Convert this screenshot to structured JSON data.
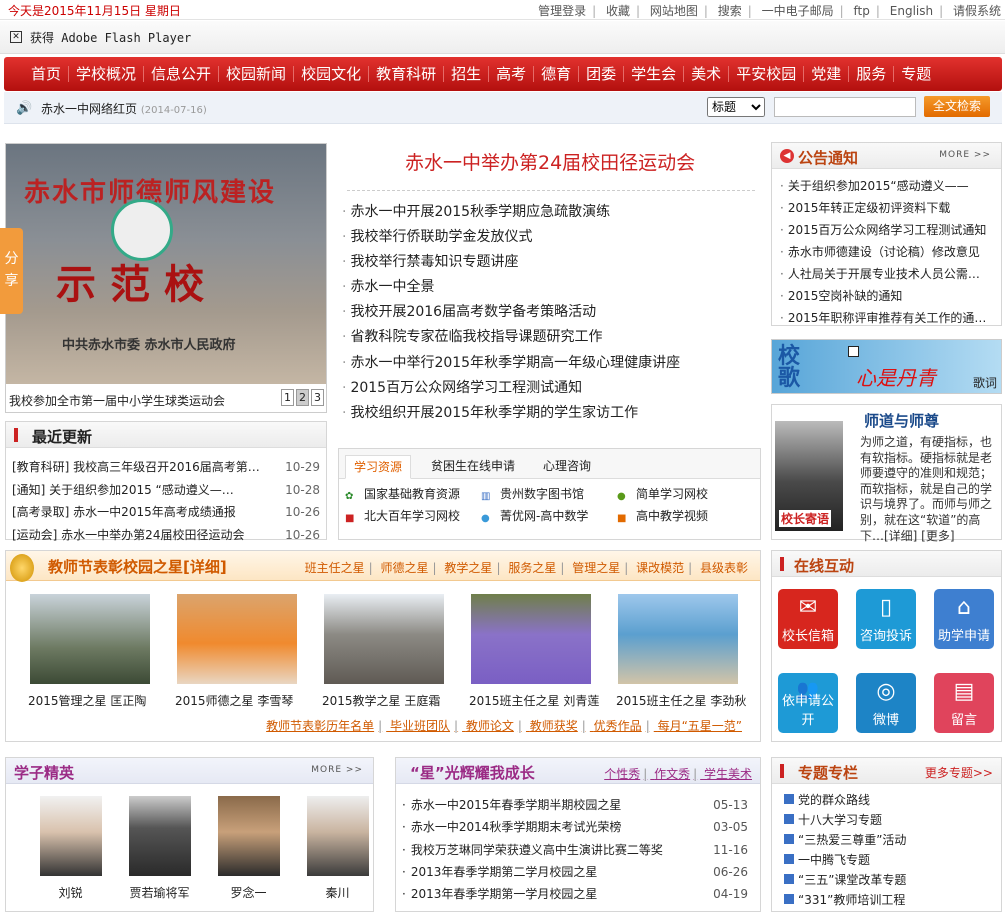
{
  "topbar": {
    "date": "今天是2015年11月15日  星期日",
    "links": [
      "管理登录",
      "收藏",
      "网站地图",
      "搜索",
      "一中电子邮局",
      "ftp",
      "English",
      "请假系统"
    ]
  },
  "flash": {
    "text": "获得 Adobe Flash Player"
  },
  "nav": [
    "首页",
    "学校概况",
    "信息公开",
    "校园新闻",
    "校园文化",
    "教育科研",
    "招生",
    "高考",
    "德育",
    "团委",
    "学生会",
    "美术",
    "平安校园",
    "党建",
    "服务",
    "专题"
  ],
  "ticker": {
    "title": "赤水一中网络红页",
    "date": "(2014-07-16)"
  },
  "search": {
    "select_value": "标题",
    "button": "全文检索"
  },
  "slideshow": {
    "caption": "我校参加全市第一届中小学生球类运动会",
    "pages": [
      "1",
      "2",
      "3"
    ],
    "share": "分享",
    "banner_top": "赤水市师德师风建设",
    "banner_mid": "示范校",
    "banner_bottom": "中共赤水市委   赤水市人民政府"
  },
  "headline": "赤水一中举办第24届校田径运动会",
  "headlines": [
    "赤水一中开展2015秋季学期应急疏散演练",
    "我校举行侨联助学金发放仪式",
    "我校举行禁毒知识专题讲座",
    "赤水一中全景",
    "我校开展2016届高考数学备考策略活动",
    "省教科院专家莅临我校指导课题研究工作",
    "赤水一中举行2015年秋季学期高一年级心理健康讲座",
    "2015百万公众网络学习工程测试通知",
    "我校组织开展2015年秋季学期的学生家访工作"
  ],
  "notice": {
    "title": "公告通知",
    "more": "MORE >>",
    "items": [
      "关于组织参加2015“感动遵义——",
      "2015年转正定级初评资料下载",
      "2015百万公众网络学习工程测试通知",
      "赤水市师德建设（讨论稿）修改意见",
      "人社局关于开展专业技术人员公需…",
      "2015空岗补缺的通知",
      "2015年职称评审推荐有关工作的通…"
    ]
  },
  "banner": {
    "text1": "校歌",
    "text2": "心是丹青",
    "text3": "歌词"
  },
  "principal": {
    "title": "师道与师尊",
    "photo_label": "校长寄语",
    "text": "为师之道，有硬指标，也有软指标。硬指标就是老师要遵守的准则和规范；而软指标，就是自己的学识与境界了。而师与师之别，就在这“软道”的高下…[详细] [更多]"
  },
  "latest": {
    "title": "最近更新",
    "items": [
      {
        "text": "[教育科研] 我校高三年级召开2016届高考第…",
        "date": "10-29"
      },
      {
        "text": "[通知] 关于组织参加2015 “感动遵义—…",
        "date": "10-28"
      },
      {
        "text": "[高考录取] 赤水一中2015年高考成绩通报",
        "date": "10-26"
      },
      {
        "text": "[运动会] 赤水一中举办第24届校田径运动会",
        "date": "10-26"
      }
    ]
  },
  "resources": {
    "tabs": [
      "学习资源",
      "贫困生在线申请",
      "心理咨询"
    ],
    "items": [
      "国家基础教育资源",
      "贵州数字图书馆",
      "简单学习网校",
      "北大百年学习网校",
      "菁优网-高中数学",
      "高中教学视频"
    ]
  },
  "teacher": {
    "title": "教师节表彰校园之星[详细]",
    "cats": [
      "班主任之星",
      "师德之星",
      "教学之星",
      "服务之星",
      "管理之星",
      "课改模范",
      "县级表彰"
    ],
    "people": [
      "2015管理之星  匡正陶",
      "2015师德之星  李雪琴",
      "2015教学之星  王庭霜",
      "2015班主任之星  刘青莲",
      "2015班主任之星  李劲秋"
    ],
    "links": [
      "教师节表彰历年名单",
      "毕业班团队",
      "教师论文",
      "教师获奖",
      "优秀作品",
      "每月“五星一范”"
    ]
  },
  "online": {
    "title": "在线互动",
    "tiles": [
      "校长信箱",
      "咨询投诉",
      "助学申请",
      "依申请公开",
      "微博",
      "留言"
    ]
  },
  "students": {
    "title": "学子精英",
    "more": "MORE >>",
    "people": [
      "刘锐",
      "贾若瑜将军",
      "罗念一",
      "秦川"
    ]
  },
  "stars": {
    "title": "“星”光辉耀我成长",
    "cats": [
      "个性秀",
      "作文秀",
      "学生美术"
    ],
    "items": [
      {
        "text": "赤水一中2015年春季学期半期校园之星",
        "date": "05-13"
      },
      {
        "text": "赤水一中2014秋季学期期末考试光荣榜",
        "date": "03-05"
      },
      {
        "text": "我校万芝琳同学荣获遵义高中生演讲比赛二等奖",
        "date": "11-16"
      },
      {
        "text": "2013年春季学期第二学月校园之星",
        "date": "06-26"
      },
      {
        "text": "2013年春季学期第一学月校园之星",
        "date": "04-19"
      }
    ]
  },
  "topics": {
    "title": "专题专栏",
    "more": "更多专题>>",
    "items": [
      "党的群众路线",
      "十八大学习专题",
      "“三热爱三尊重”活动",
      "一中腾飞专题",
      "“三五”课堂改革专题",
      "“331”教师培训工程"
    ]
  },
  "colors": {
    "nav_red": "#c71f1c",
    "accent_orange": "#e26a00",
    "title_purple": "#9b2b85"
  }
}
